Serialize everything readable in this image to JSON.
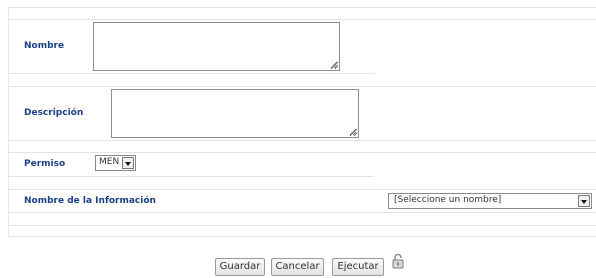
{
  "form": {
    "nombre_label": "Nombre",
    "nombre_value": "",
    "descripcion_label": "Descripción",
    "descripcion_value": "",
    "permiso_label": "Permiso",
    "permiso_selected": "MEN",
    "info_label": "Nombre de la Información",
    "info_selected": "[Seleccione un nombre]"
  },
  "buttons": {
    "guardar": "Guardar",
    "cancelar": "Cancelar",
    "ejecutar": "Ejecutar"
  },
  "icons": {
    "dropdown": "chevron-down-icon",
    "lock": "lock-icon"
  },
  "colors": {
    "label": "#1b3f86",
    "separator": "#e3e3e3"
  }
}
